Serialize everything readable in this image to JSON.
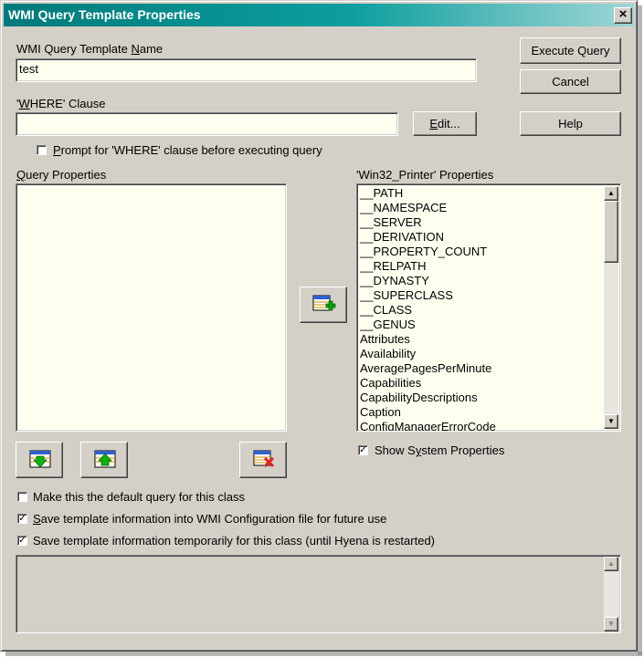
{
  "window": {
    "title": "WMI Query Template Properties",
    "close_glyph": "×"
  },
  "template_name": {
    "label_pre": "WMI Query Template ",
    "label_ul": "N",
    "label_post": "ame",
    "value": "test"
  },
  "where_clause": {
    "label_pre": "'",
    "label_ul": "W",
    "label_post": "HERE' Clause",
    "value": ""
  },
  "buttons": {
    "execute": "Execute Query",
    "cancel": "Cancel",
    "help": "Help",
    "edit_ul": "E",
    "edit_post": "dit..."
  },
  "prompt_checkbox": {
    "label_ul": "P",
    "label_post": "rompt for 'WHERE' clause before executing query",
    "checked": false
  },
  "query_properties": {
    "label_ul": "Q",
    "label_post": "uery Properties",
    "items": []
  },
  "class_properties": {
    "label": "'Win32_Printer' Properties",
    "items": [
      "__PATH",
      "__NAMESPACE",
      "__SERVER",
      "__DERIVATION",
      "__PROPERTY_COUNT",
      "__RELPATH",
      "__DYNASTY",
      "__SUPERCLASS",
      "__CLASS",
      "__GENUS",
      "Attributes",
      "Availability",
      "AveragePagesPerMinute",
      "Capabilities",
      "CapabilityDescriptions",
      "Caption",
      "ConfigManagerErrorCode"
    ]
  },
  "show_system": {
    "label_pre": "Show S",
    "label_ul": "y",
    "label_post": "stem Properties",
    "checked": true
  },
  "options": {
    "default_query": {
      "label": "Make this the default query for this class",
      "checked": false
    },
    "save_config": {
      "label_ul": "S",
      "label_post": "ave template information into WMI Configuration file for future use",
      "checked": true
    },
    "save_temp": {
      "label": "Save template information temporarily for this class (until Hyena is restarted)",
      "checked": true
    }
  },
  "description": "",
  "icons": {
    "add": "add-property-icon",
    "move_down": "move-down-icon",
    "move_up": "move-up-icon",
    "remove": "remove-property-icon"
  },
  "colors": {
    "title_start": "#007a7a",
    "field_bg": "#fffff0",
    "face": "#d4d0c8"
  }
}
